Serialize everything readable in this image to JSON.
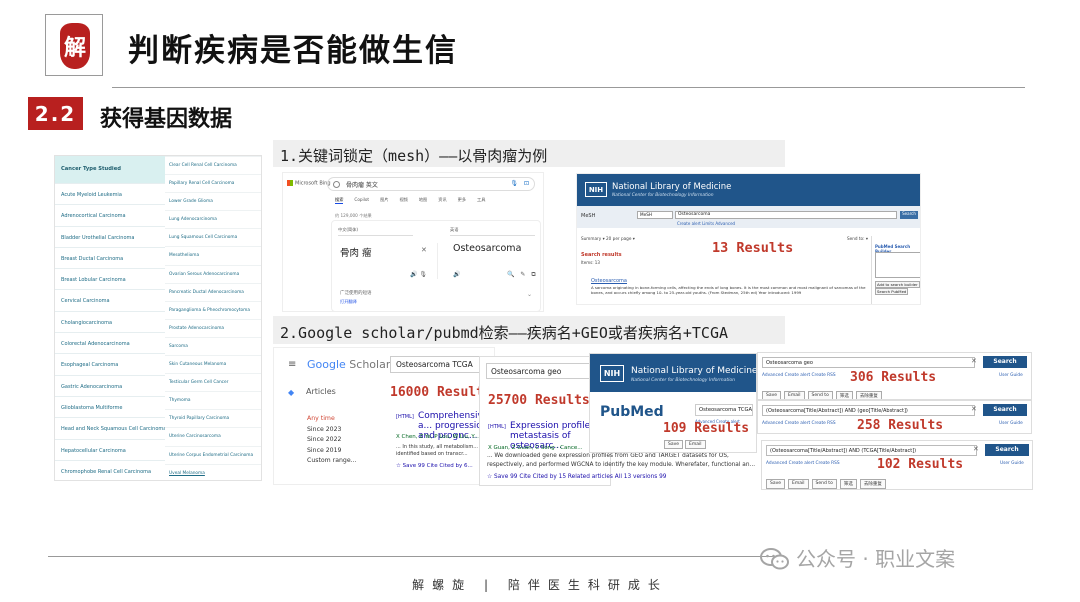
{
  "header": {
    "logo_text": "解",
    "title": "判断疾病是否能做生信"
  },
  "section": {
    "number": "2.2",
    "title": "获得基因数据"
  },
  "cancer_types": {
    "header": "Cancer Type Studied",
    "col1": [
      "Acute Myeloid Leukemia",
      "Adrenocortical Carcinoma",
      "Bladder Urothelial Carcinoma",
      "Breast Ductal Carcinoma",
      "Breast Lobular Carcinoma",
      "Cervical Carcinoma",
      "Cholangiocarcinoma",
      "Colorectal Adenocarcinoma",
      "Esophageal Carcinoma",
      "Gastric Adenocarcinoma",
      "Glioblastoma Multiforme",
      "Head and Neck Squamous Cell Carcinoma",
      "Hepatocellular Carcinoma",
      "Chromophobe Renal Cell Carcinoma"
    ],
    "col2": [
      "Clear Cell Renal Cell Carcinoma",
      "Papillary Renal Cell Carcinoma",
      "Lower Grade Glioma",
      "Lung Adenocarcinoma",
      "Lung Squamous Cell Carcinoma",
      "Mesothelioma",
      "Ovarian Serous Adenocarcinoma",
      "Pancreatic Ductal Adenocarcinoma",
      "Paraganglioma & Pheochromocytoma",
      "Prostate Adenocarcinoma",
      "Sarcoma",
      "Skin Cutaneous Melanoma",
      "Testicular Germ Cell Cancer",
      "Thymoma",
      "Thyroid Papillary Carcinoma",
      "Uterine Carcinosarcoma",
      "Uterine Corpus Endometrial Carcinoma",
      "Uveal Melanoma"
    ]
  },
  "step1": {
    "caption": "1.关键词锁定（mesh）——以骨肉瘤为例"
  },
  "step2": {
    "caption": "2.Google scholar/pubmd检索——疾病名+GEO或者疾病名+TCGA"
  },
  "bing": {
    "brand": "Microsoft Bing",
    "query": "骨肉瘤 英文",
    "tabs": [
      "搜索",
      "Copilot",
      "图片",
      "视频",
      "地图",
      "资讯",
      "更多",
      "工具"
    ],
    "result_count": "约 129,000 个结果",
    "source_lang": "中文(简体)",
    "target_lang": "英语",
    "source_text": "骨肉 瘤",
    "target_text": "Osteosarcoma",
    "footer": "广泛使用的短语",
    "footer_link": "打开翻译"
  },
  "mesh": {
    "nlm_logo": "NIH",
    "nlm_name": "National Library of Medicine",
    "nlm_sub": "National Center for Biotechnology Information",
    "db_label": "MeSH",
    "db_select": "MeSH",
    "query": "Osteosarcoma",
    "search_btn": "Search",
    "sub_links": "Create alert   Limits   Advanced",
    "summary": "Summary ▾  20 per page ▾",
    "send_to": "Send to: ▾",
    "results_annotation": "13 Results",
    "search_results": "Search results",
    "items": "Items: 13",
    "term": "Osteosarcoma",
    "desc": "A sarcoma originating in bone-forming cells, affecting the ends of long bones. It is the most common and most malignant of sarcomas of the bones, and occurs chiefly among 10- to 25-year-old youths. (From Stedman, 25th ed) Year introduced: 1999",
    "side_title": "PubMed Search Builder",
    "side_btn1": "Add to search builder",
    "side_btn2": "Search PubMed"
  },
  "scholar": {
    "brand": "Google",
    "brand_suffix": "Scholar",
    "query": "Osteosarcoma TCGA",
    "articles": "Articles",
    "results_annotation": "16000 Results",
    "years": [
      "Any time",
      "Since 2023",
      "Since 2022",
      "Since 2019",
      "Custom range..."
    ],
    "r1_tag": "[HTML]",
    "r1_title": "Comprehensive a... progression and prognc...",
    "r1_authors": "X Chen, Z Ye, P Lou, W Liu, Y...",
    "r1_snippet": "... In this study, all metabolism... and identified based on transcr...",
    "r1_actions": "☆ Save  99 Cite  Cited by 6..."
  },
  "pubmed_geo": {
    "query": "Osteosarcoma geo",
    "results_annotation": "25700 Results",
    "r_tag": "[HTML]",
    "r_title": "Expression profile a... metastasis of osteosarc...",
    "r_authors": "X Guan, Z Guan, C Song - Cance...",
    "r_snippet": "... We downloaded gene expression profiles from GEO and TARGET datasets for OS, respectively, and performed WGCNA to identify the key module. Wherefater, functional an...",
    "r_actions": "☆ Save  99 Cite  Cited by 15   Related articles   All 13 versions   99"
  },
  "pubmed_tcga": {
    "nlm_logo": "NIH",
    "nlm_name": "National Library of Medicine",
    "nlm_sub": "National Center for Biotechnology Information",
    "pubmed_logo": "PubMed",
    "query": "Osteosarcoma TCGA",
    "results_annotation": "109 Results",
    "links": "Advanced  Create alert",
    "buttons": [
      "Save",
      "Email"
    ]
  },
  "adv1": {
    "query": "Osteosarcoma geo",
    "search_btn": "Search",
    "links": "Advanced   Create alert   Create RSS",
    "user_guide": "User Guide",
    "results_annotation": "306 Results",
    "buttons": [
      "Save",
      "Email",
      "Send to",
      "筛选",
      "去除重复"
    ]
  },
  "adv2": {
    "query": "(Osteosarcoma[Title/Abstract]) AND (geo[Title/Abstract])",
    "search_btn": "Search",
    "links": "Advanced   Create alert   Create RSS",
    "user_guide": "User Guide",
    "results_annotation": "258 Results"
  },
  "adv3": {
    "query": "(Osteosarcoma[Title/Abstract]) AND (TCGA[Title/Abstract])",
    "search_btn": "Search",
    "links": "Advanced   Create alert   Create RSS",
    "user_guide": "User Guide",
    "results_annotation": "102 Results",
    "buttons": [
      "Save",
      "Email",
      "Send to",
      "筛选",
      "去除重复"
    ]
  },
  "footer": {
    "watermark": "公众号 · 职业文案",
    "tagline": "解螺旋  |  陪伴医生科研成长"
  }
}
